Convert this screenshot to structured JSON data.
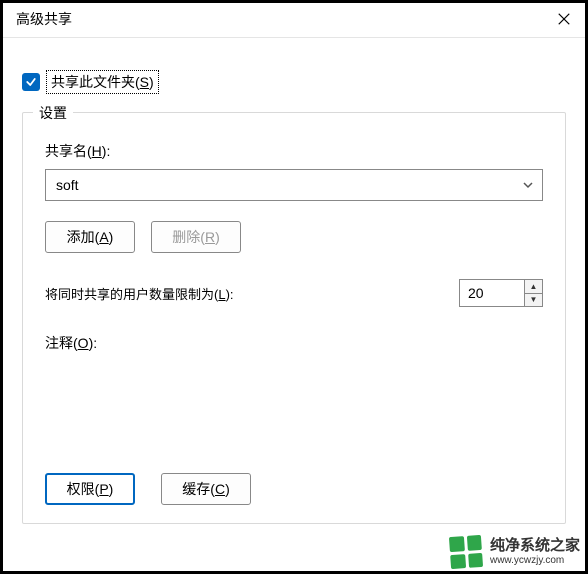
{
  "window": {
    "title": "高级共享"
  },
  "share_checkbox": {
    "checked": true,
    "label_pre": "共享此文件夹(",
    "label_hot": "S",
    "label_post": ")"
  },
  "group": {
    "legend": "设置",
    "share_name_label_pre": "共享名(",
    "share_name_label_hot": "H",
    "share_name_label_post": "):",
    "share_name_value": "soft",
    "add_btn_pre": "添加(",
    "add_btn_hot": "A",
    "add_btn_post": ")",
    "remove_btn_pre": "删除(",
    "remove_btn_hot": "R",
    "remove_btn_post": ")",
    "limit_label_pre": "将同时共享的用户数量限制为(",
    "limit_label_hot": "L",
    "limit_label_post": "):",
    "limit_value": "20",
    "comment_label_pre": "注释(",
    "comment_label_hot": "O",
    "comment_label_post": "):",
    "perm_btn_pre": "权限(",
    "perm_btn_hot": "P",
    "perm_btn_post": ")",
    "cache_btn_pre": "缓存(",
    "cache_btn_hot": "C",
    "cache_btn_post": ")"
  },
  "watermark": {
    "cn": "纯净系统之家",
    "url": "www.ycwzjy.com"
  }
}
